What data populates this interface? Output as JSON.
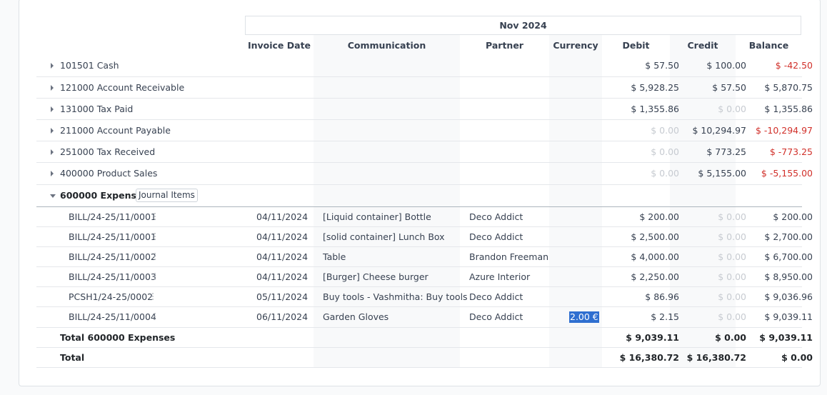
{
  "period": "Nov 2024",
  "columns": {
    "invoice_date": "Invoice Date",
    "communication": "Communication",
    "partner": "Partner",
    "currency": "Currency",
    "debit": "Debit",
    "credit": "Credit",
    "balance": "Balance"
  },
  "accounts": [
    {
      "label": "101501 Cash",
      "debit": "$ 57.50",
      "credit": "$ 100.00",
      "balance": "$ -42.50"
    },
    {
      "label": "121000 Account Receivable",
      "debit": "$ 5,928.25",
      "credit": "$ 57.50",
      "balance": "$ 5,870.75"
    },
    {
      "label": "131000 Tax Paid",
      "debit": "$ 1,355.86",
      "credit": "$ 0.00",
      "balance": "$ 1,355.86"
    },
    {
      "label": "211000 Account Payable",
      "debit": "$ 0.00",
      "credit": "$ 10,294.97",
      "balance": "$ -10,294.97"
    },
    {
      "label": "251000 Tax Received",
      "debit": "$ 0.00",
      "credit": "$ 773.25",
      "balance": "$ -773.25"
    },
    {
      "label": "400000 Product Sales",
      "debit": "$ 0.00",
      "credit": "$ 5,155.00",
      "balance": "$ -5,155.00"
    }
  ],
  "expenses": {
    "label": "600000 Expenses",
    "journal_button": "Journal Items",
    "lines": [
      {
        "ref": "BILL/24-25/11/0001",
        "date": "04/11/2024",
        "communication": "[Liquid container] Bottle",
        "partner": "Deco Addict",
        "currency": "",
        "debit": "$ 200.00",
        "credit": "$ 0.00",
        "balance": "$ 200.00"
      },
      {
        "ref": "BILL/24-25/11/0001",
        "date": "04/11/2024",
        "communication": "[solid container] Lunch Box",
        "partner": "Deco Addict",
        "currency": "",
        "debit": "$ 2,500.00",
        "credit": "$ 0.00",
        "balance": "$ 2,700.00"
      },
      {
        "ref": "BILL/24-25/11/0002",
        "date": "04/11/2024",
        "communication": "Table",
        "partner": "Brandon Freeman",
        "currency": "",
        "debit": "$ 4,000.00",
        "credit": "$ 0.00",
        "balance": "$ 6,700.00"
      },
      {
        "ref": "BILL/24-25/11/0003",
        "date": "04/11/2024",
        "communication": "[Burger] Cheese burger",
        "partner": "Azure Interior",
        "currency": "",
        "debit": "$ 2,250.00",
        "credit": "$ 0.00",
        "balance": "$ 8,950.00"
      },
      {
        "ref": "PCSH1/24-25/0002",
        "date": "05/11/2024",
        "communication": "Buy tools - Vashmitha: Buy tools",
        "partner": "Deco Addict",
        "currency": "",
        "debit": "$ 86.96",
        "credit": "$ 0.00",
        "balance": "$ 9,036.96"
      },
      {
        "ref": "BILL/24-25/11/0004",
        "date": "06/11/2024",
        "communication": "Garden Gloves",
        "partner": "Deco Addict",
        "currency": "2.00 €",
        "debit": "$ 2.15",
        "credit": "$ 0.00",
        "balance": "$ 9,039.11"
      }
    ],
    "total_label": "Total 600000 Expenses",
    "total_debit": "$ 9,039.11",
    "total_credit": "$ 0.00",
    "total_balance": "$ 9,039.11"
  },
  "grand_total": {
    "label": "Total",
    "debit": "$ 16,380.72",
    "credit": "$ 16,380.72",
    "balance": "$ 0.00"
  },
  "colors": {
    "negative": "#d1302a",
    "muted": "#c7cbd1",
    "selection": "#2f6fd0"
  }
}
